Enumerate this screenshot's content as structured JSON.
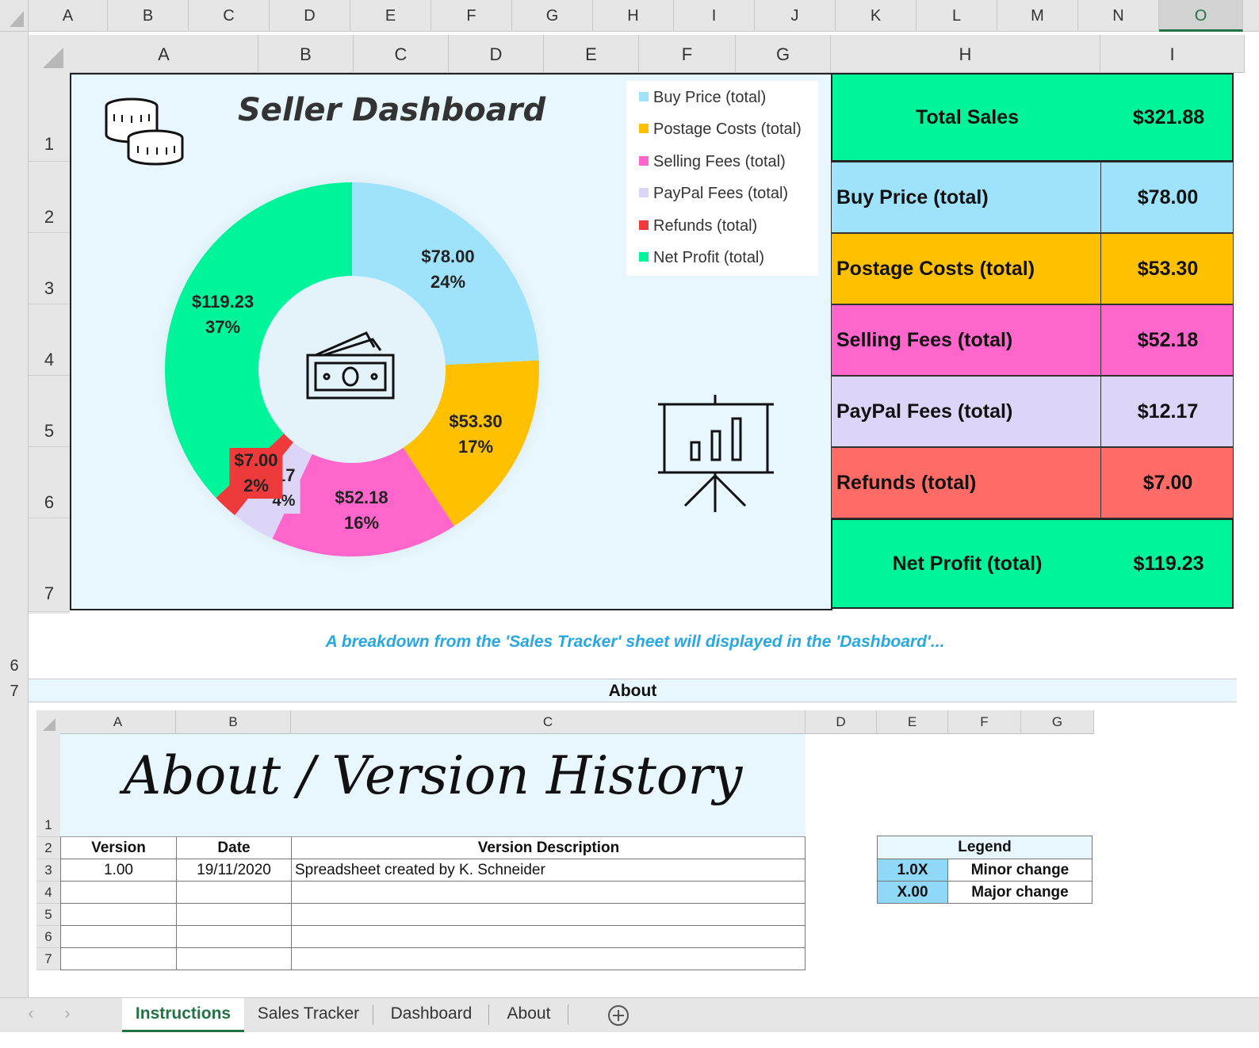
{
  "outer": {
    "columns": [
      "A",
      "B",
      "C",
      "D",
      "E",
      "F",
      "G",
      "H",
      "I",
      "J",
      "K",
      "L",
      "M",
      "N",
      "O"
    ],
    "rows": [
      "6",
      "7"
    ]
  },
  "dashboard": {
    "columns": [
      "A",
      "B",
      "C",
      "D",
      "E",
      "F",
      "G",
      "H",
      "I"
    ],
    "rows": [
      "1",
      "2",
      "3",
      "4",
      "5",
      "6",
      "7"
    ],
    "title": "Seller Dashboard",
    "legend": [
      {
        "label": "Buy Price (total)",
        "color": "#9ee3fb"
      },
      {
        "label": "Postage Costs (total)",
        "color": "#ffc000"
      },
      {
        "label": "Selling Fees (total)",
        "color": "#ff66cc"
      },
      {
        "label": "PayPal Fees (total)",
        "color": "#ddd5f7"
      },
      {
        "label": "Refunds (total)",
        "color": "#ee3a3a"
      },
      {
        "label": "Net Profit (total)",
        "color": "#00f59a"
      }
    ],
    "slices": [
      {
        "value_label": "$78.00",
        "pct_label": "24%",
        "value": 78.0
      },
      {
        "value_label": "$53.30",
        "pct_label": "17%",
        "value": 53.3
      },
      {
        "value_label": "$52.18",
        "pct_label": "16%",
        "value": 52.18
      },
      {
        "value_label": "17",
        "pct_label": "4%",
        "value": 12.17
      },
      {
        "value_label": "$7.00",
        "pct_label": "2%",
        "value": 7.0
      },
      {
        "value_label": "$119.23",
        "pct_label": "37%",
        "value": 119.23
      }
    ],
    "summary": {
      "total_sales_label": "Total Sales",
      "total_sales_value": "$321.88",
      "rows": [
        {
          "label": "Buy Price (total)",
          "value": "$78.00",
          "color": "#9ee3fb"
        },
        {
          "label": "Postage Costs (total)",
          "value": "$53.30",
          "color": "#ffc000"
        },
        {
          "label": "Selling Fees (total)",
          "value": "$52.18",
          "color": "#ff66cc"
        },
        {
          "label": "PayPal Fees (total)",
          "value": "$12.17",
          "color": "#ddd5f7"
        },
        {
          "label": "Refunds (total)",
          "value": "$7.00",
          "color": "#ff6b66"
        }
      ],
      "net_profit_label": "Net Profit (total)",
      "net_profit_value": "$119.23",
      "accent_color": "#00f59a"
    }
  },
  "note": "A breakdown from the 'Sales Tracker' sheet will displayed in the 'Dashboard'...",
  "about_bar": "About",
  "about": {
    "columns": [
      "A",
      "B",
      "C",
      "D",
      "E",
      "F",
      "G"
    ],
    "rows": [
      "1",
      "2",
      "3",
      "4",
      "5",
      "6",
      "7"
    ],
    "title": "About / Version History",
    "headers": [
      "Version",
      "Date",
      "Version Description"
    ],
    "entries": [
      {
        "version": "1.00",
        "date": "19/11/2020",
        "description": "Spreadsheet created by K. Schneider"
      },
      {
        "version": "",
        "date": "",
        "description": ""
      },
      {
        "version": "",
        "date": "",
        "description": ""
      },
      {
        "version": "",
        "date": "",
        "description": ""
      },
      {
        "version": "",
        "date": "",
        "description": ""
      }
    ],
    "legend": {
      "title": "Legend",
      "items": [
        {
          "code": "1.0X",
          "meaning": "Minor change"
        },
        {
          "code": "X.00",
          "meaning": "Major change"
        }
      ]
    }
  },
  "tabs": [
    "Instructions",
    "Sales Tracker",
    "Dashboard",
    "About"
  ],
  "active_tab": "Instructions"
}
